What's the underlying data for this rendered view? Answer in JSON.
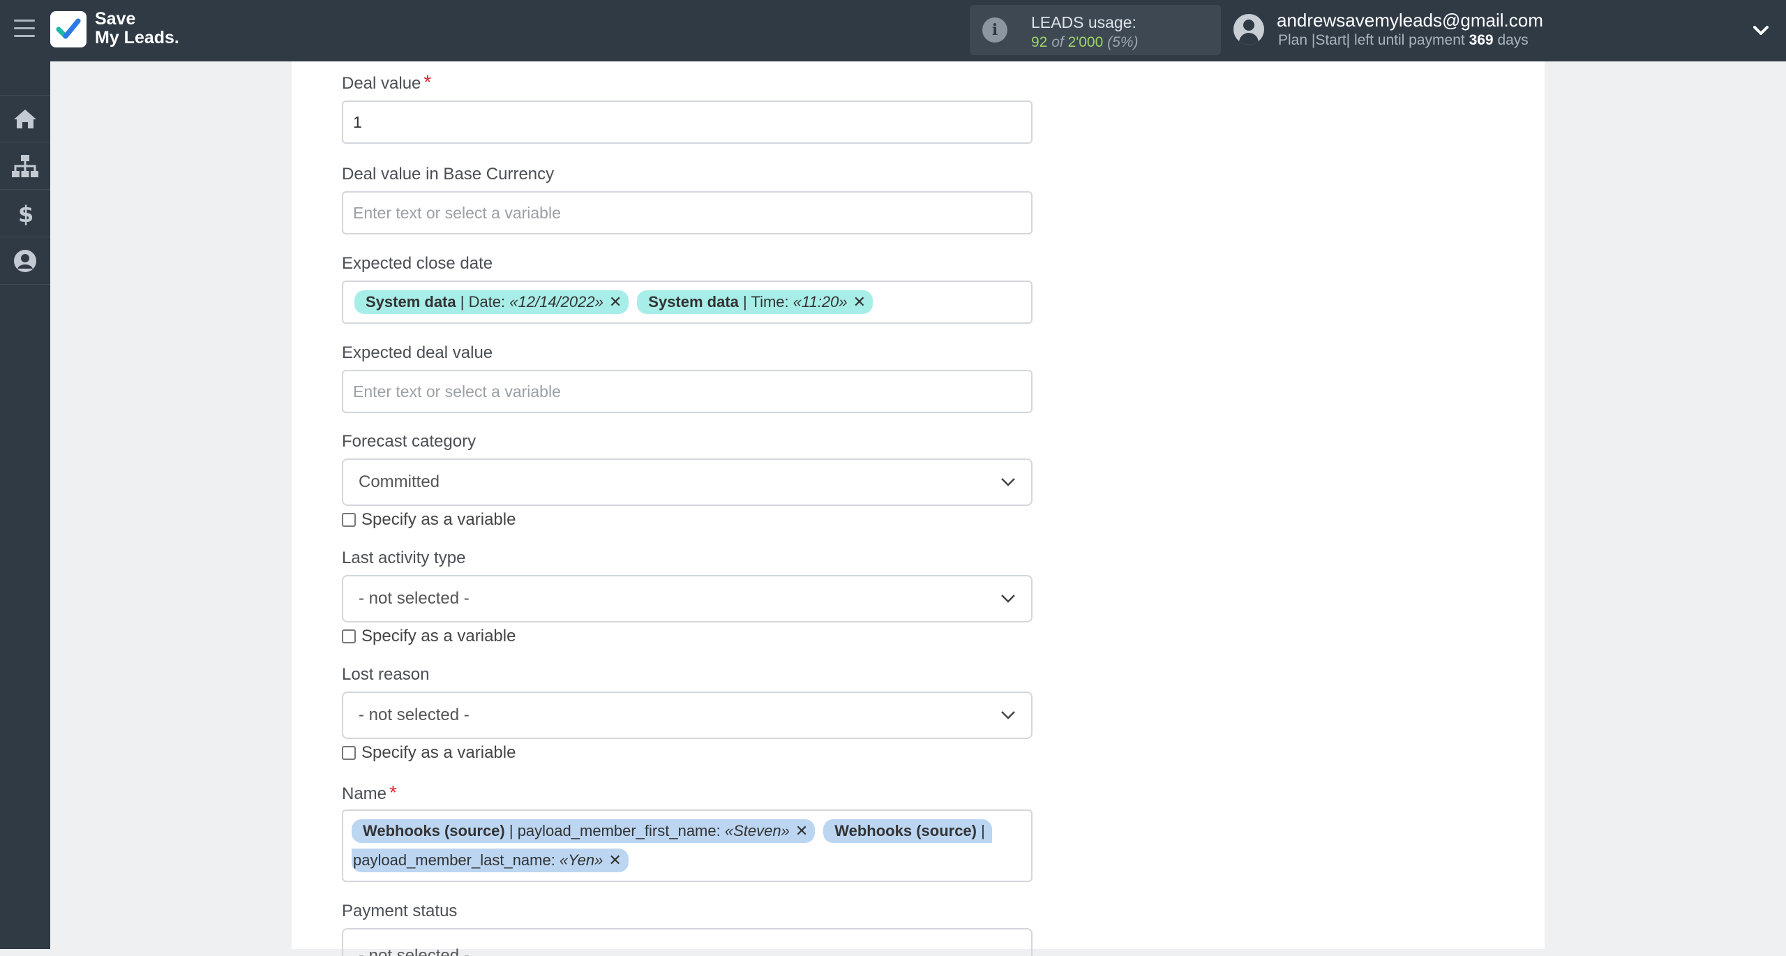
{
  "header": {
    "logo_line1": "Save",
    "logo_line2": "My Leads.",
    "usage_label": "LEADS usage:",
    "usage_used": "92",
    "usage_of": "of",
    "usage_total": "2'000",
    "usage_percent": "(5%)",
    "user_email": "andrewsavemyleads@gmail.com",
    "plan_prefix": "Plan |Start| left until payment",
    "plan_days": "369",
    "plan_suffix": "days"
  },
  "sidebar": {
    "items": [
      {
        "icon": "home-icon"
      },
      {
        "icon": "sitemap-icon"
      },
      {
        "icon": "dollar-icon"
      },
      {
        "icon": "user-circle-icon"
      }
    ]
  },
  "form": {
    "deal_value": {
      "label": "Deal value",
      "value": "1"
    },
    "deal_value_base": {
      "label": "Deal value in Base Currency",
      "placeholder": "Enter text or select a variable"
    },
    "expected_close_date": {
      "label": "Expected close date",
      "tags": [
        {
          "source": "System data",
          "sep": " | Date: ",
          "value": "«12/14/2022»"
        },
        {
          "source": "System data",
          "sep": " | Time: ",
          "value": "«11:20»"
        }
      ]
    },
    "expected_deal_value": {
      "label": "Expected deal value",
      "placeholder": "Enter text or select a variable"
    },
    "forecast_category": {
      "label": "Forecast category",
      "value": "Committed",
      "checkbox": "Specify as a variable"
    },
    "last_activity_type": {
      "label": "Last activity type",
      "value": "- not selected -",
      "checkbox": "Specify as a variable"
    },
    "lost_reason": {
      "label": "Lost reason",
      "value": "- not selected -",
      "checkbox": "Specify as a variable"
    },
    "name": {
      "label": "Name",
      "tag1": {
        "source": "Webhooks (source)",
        "sep": " | payload_member_first_name: ",
        "value": "«Steven»"
      },
      "tag2_source": "Webhooks (source)",
      "tag2_sep": " |",
      "tag2_line2": "payload_member_last_name: ",
      "tag2_value": "«Yen»"
    },
    "payment_status": {
      "label": "Payment status",
      "value": "- not selected -"
    }
  },
  "colors": {
    "topbar": "#2f3a45",
    "tag_cyan": "#a8eee8",
    "tag_blue": "#bcd6f2",
    "required": "#d9282f",
    "usage_green": "#9fd36b"
  }
}
